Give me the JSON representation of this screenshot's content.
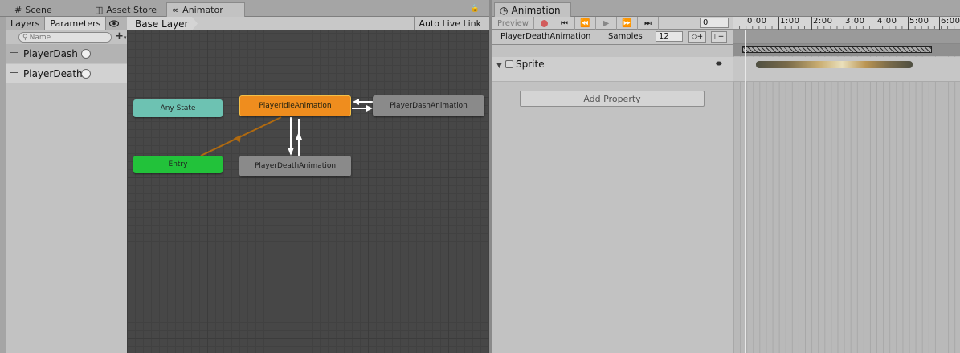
{
  "tabs": [
    {
      "icon": "grid-icon",
      "label": "Scene"
    },
    {
      "icon": "store-icon",
      "label": "Asset Store"
    },
    {
      "icon": "animator-icon",
      "label": "Animator"
    }
  ],
  "animator": {
    "left_tabs": {
      "layers": "Layers",
      "parameters": "Parameters"
    },
    "search_placeholder": "Name",
    "parameters": [
      {
        "name": "PlayerDash",
        "type": "Trigger"
      },
      {
        "name": "PlayerDeath",
        "type": "Trigger"
      }
    ],
    "breadcrumb": "Base Layer",
    "auto_live_link": "Auto Live Link",
    "nodes": {
      "any_state": "Any State",
      "entry": "Entry",
      "idle": "PlayerIdleAnimation",
      "dash": "PlayerDashAnimation",
      "death": "PlayerDeathAnimation"
    }
  },
  "animation": {
    "tab_label": "Animation",
    "toolbar": {
      "preview": "Preview",
      "frame": "0"
    },
    "clip_name": "PlayerDeathAnimation",
    "samples_label": "Samples",
    "samples_value": "12",
    "property": "Sprite",
    "add_property": "Add Property",
    "ruler": [
      "0:00",
      "1:00",
      "2:00",
      "3:00",
      "4:00",
      "5:00",
      "6:00"
    ]
  },
  "colors": {
    "any_state": "#6dc2b2",
    "entry": "#22c23a",
    "default_state": "#ef8d1e",
    "state": "#8a8a8a",
    "record": "#d25c5c"
  }
}
